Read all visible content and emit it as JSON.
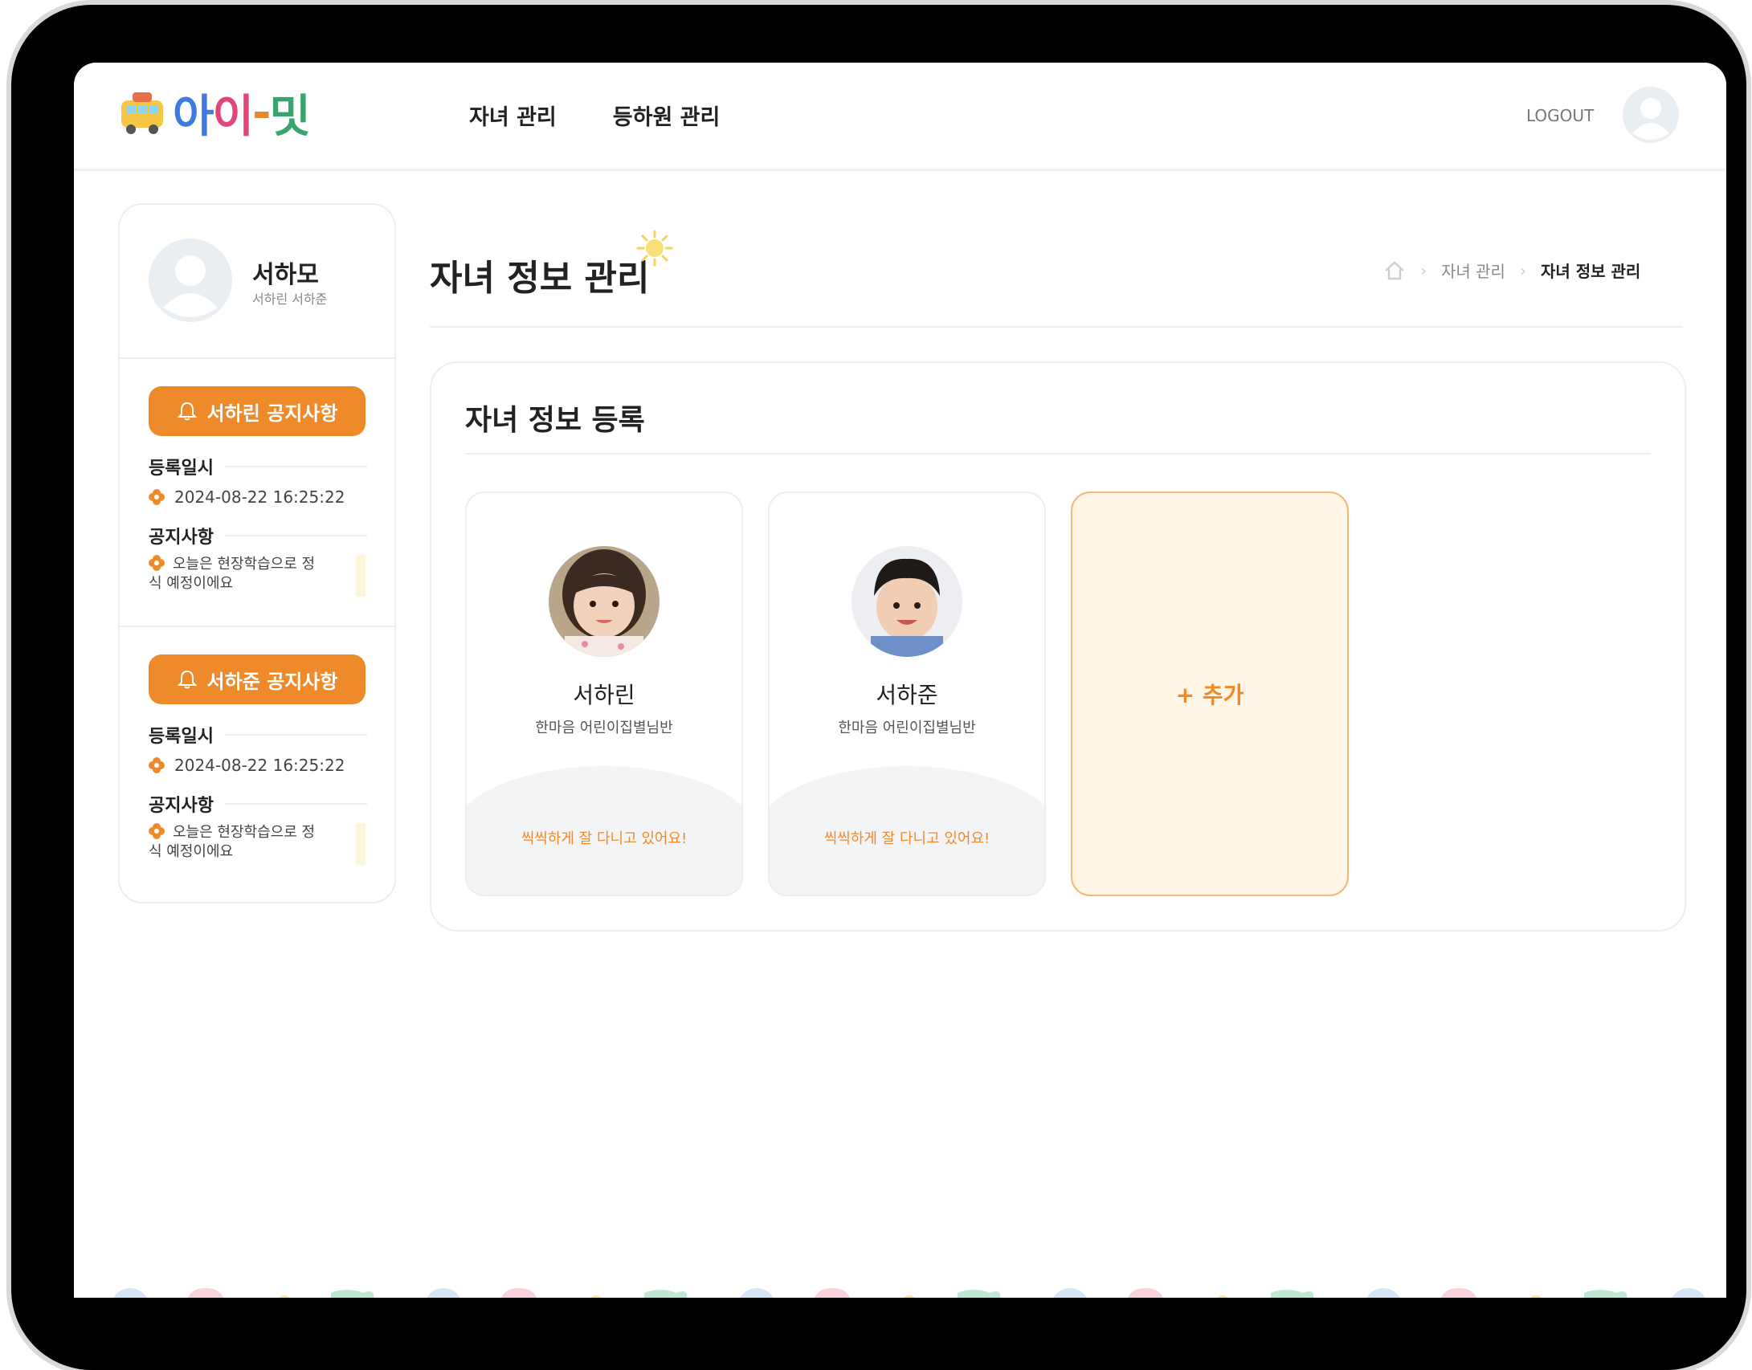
{
  "header": {
    "logo_text": "아이-밋",
    "nav": [
      {
        "label": "자녀 관리"
      },
      {
        "label": "등하원 관리"
      }
    ],
    "logout_label": "LOGOUT"
  },
  "sidebar": {
    "profile": {
      "name": "서하모",
      "children": "서하린 서하준"
    },
    "notices": [
      {
        "button_label": "서하린 공지사항",
        "date_label": "등록일시",
        "date_value": "2024-08-22 16:25:22",
        "notice_label": "공지사항",
        "notice_value": "오늘은 현장학습으로 정식 예정이에요"
      },
      {
        "button_label": "서하준 공지사항",
        "date_label": "등록일시",
        "date_value": "2024-08-22 16:25:22",
        "notice_label": "공지사항",
        "notice_value": "오늘은 현장학습으로 정식 예정이에요"
      }
    ]
  },
  "main": {
    "title": "자녀 정보 관리",
    "breadcrumb": [
      "자녀 관리",
      "자녀 정보 관리"
    ],
    "panel_title": "자녀 정보 등록",
    "children": [
      {
        "name": "서하린",
        "class": "한마음 어린이집별님반",
        "status": "씩씩하게 잘 다니고 있어요!"
      },
      {
        "name": "서하준",
        "class": "한마음 어린이집별님반",
        "status": "씩씩하게 잘 다니고 있어요!"
      }
    ],
    "add_label": "+ 추가"
  },
  "colors": {
    "accent": "#ee8a2a",
    "add_card_bg": "#fff5e4",
    "device_frame": "#000000"
  }
}
